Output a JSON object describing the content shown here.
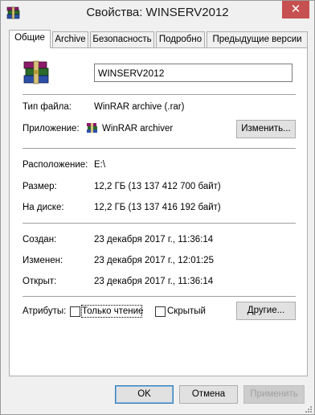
{
  "window": {
    "title": "Свойства: WINSERV2012",
    "close_label": "✕"
  },
  "tabs": [
    {
      "label": "Общие",
      "active": true
    },
    {
      "label": "Archive",
      "active": false
    },
    {
      "label": "Безопасность",
      "active": false
    },
    {
      "label": "Подробно",
      "active": false
    },
    {
      "label": "Предыдущие версии",
      "active": false
    }
  ],
  "general": {
    "file_name": "WINSERV2012",
    "file_type_label": "Тип файла:",
    "file_type_value": "WinRAR archive (.rar)",
    "app_label": "Приложение:",
    "app_value": "WinRAR archiver",
    "change_button": "Изменить...",
    "location_label": "Расположение:",
    "location_value": "E:\\",
    "size_label": "Размер:",
    "size_value": "12,2 ГБ (13 137 412 700 байт)",
    "disk_label": "На диске:",
    "disk_value": "12,2 ГБ (13 137 416 192 байт)",
    "created_label": "Создан:",
    "created_value": "23 декабря 2017 г., 11:36:14",
    "modified_label": "Изменен:",
    "modified_value": "23 декабря 2017 г., 12:01:25",
    "opened_label": "Открыт:",
    "opened_value": "23 декабря 2017 г., 11:36:14",
    "attributes_label": "Атрибуты:",
    "readonly_label": "Только чтение",
    "readonly_checked": false,
    "hidden_label": "Скрытый",
    "hidden_checked": false,
    "other_button": "Другие..."
  },
  "footer": {
    "ok": "OK",
    "cancel": "Отмена",
    "apply": "Применить"
  },
  "icons": {
    "app_icon": "winrar-books-icon",
    "close": "close-icon"
  },
  "colors": {
    "close_button": "#c75050",
    "panel": "#ffffff",
    "dialog": "#f0f0f0",
    "default_button_border": "#3c7fb1"
  }
}
